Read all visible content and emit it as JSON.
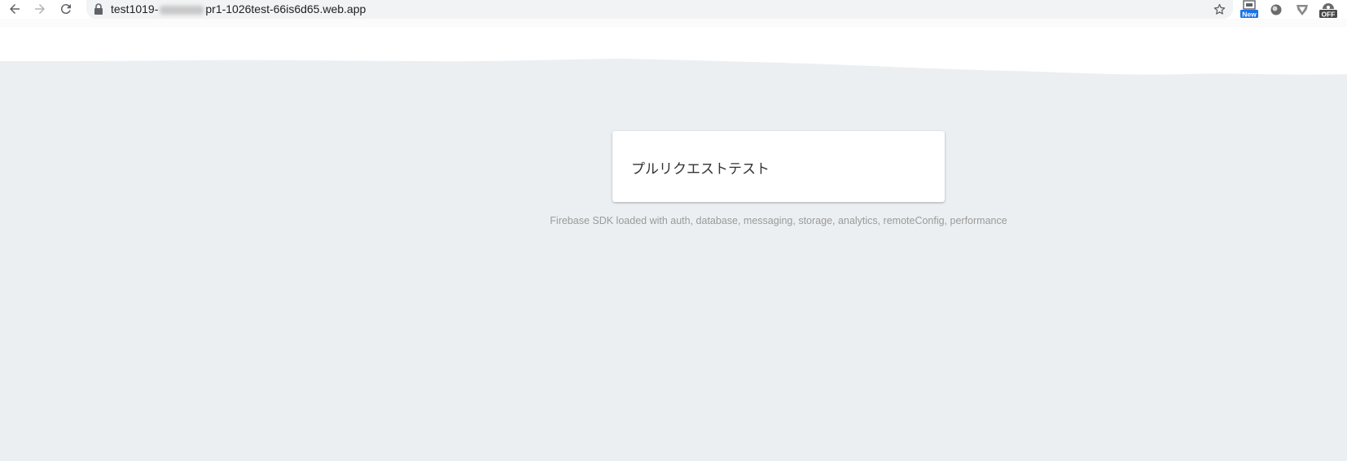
{
  "browser": {
    "url_prefix": "test1019-",
    "url_suffix": "pr1-1026test-66is6d65.web.app",
    "extensions": {
      "new_badge": "New",
      "off_badge": "OFF"
    }
  },
  "page": {
    "card_title": "プルリクエストテスト",
    "status_text": "Firebase SDK loaded with auth, database, messaging, storage, analytics, remoteConfig, performance"
  },
  "colors": {
    "background": "#eceff1",
    "card": "#ffffff",
    "status_text": "#9a9a9a",
    "new_badge": "#1a73e8"
  }
}
